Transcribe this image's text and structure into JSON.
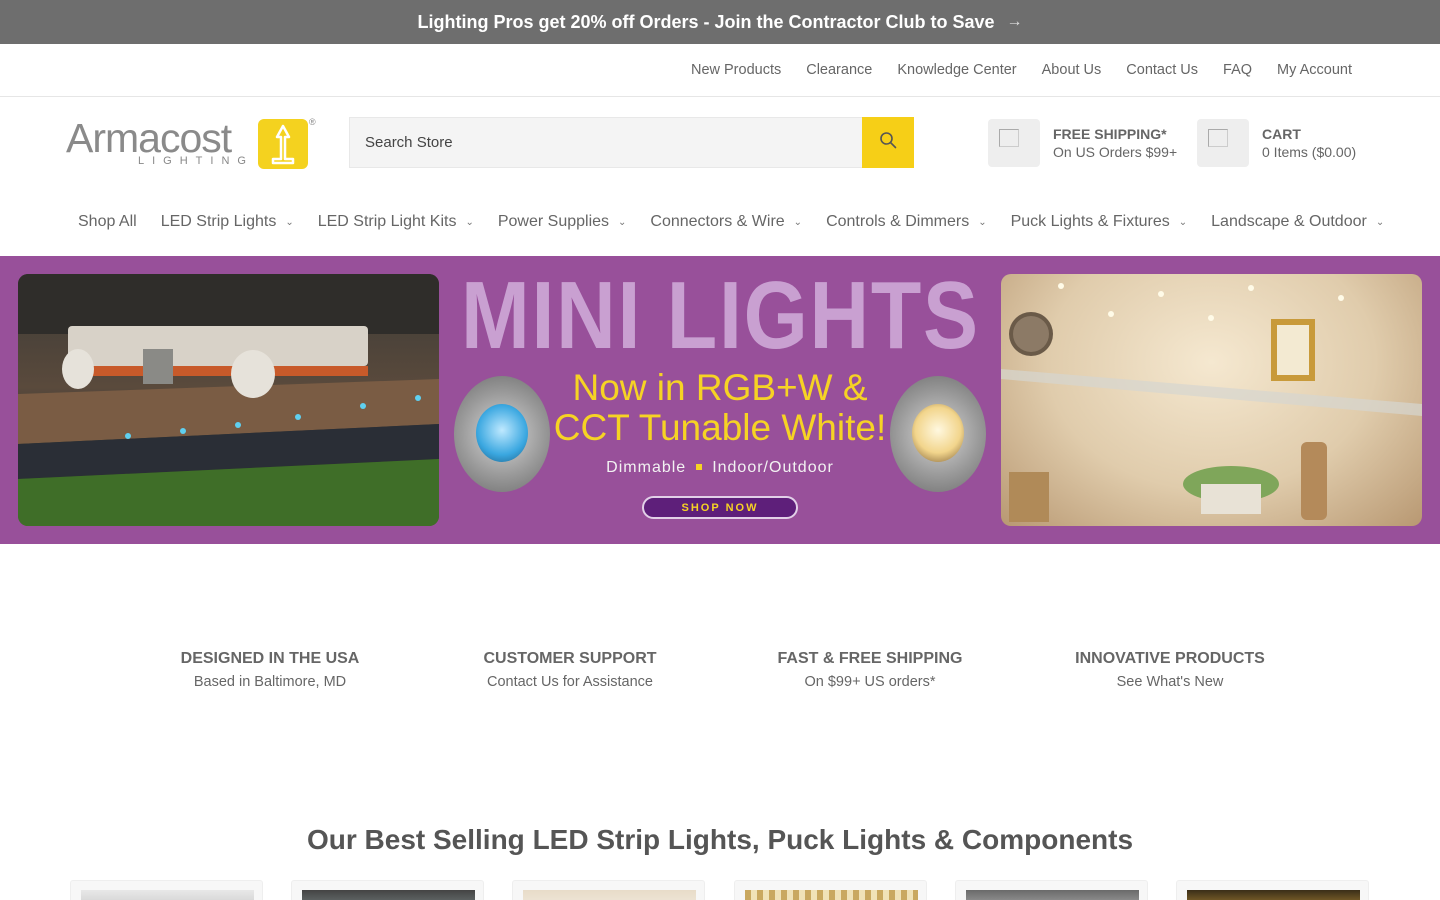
{
  "announcement": {
    "text": "Lighting Pros get 20% off Orders - Join the Contractor Club to Save",
    "arrow": "→"
  },
  "utility_nav": [
    "New Products",
    "Clearance",
    "Knowledge Center",
    "About Us",
    "Contact Us",
    "FAQ",
    "My Account"
  ],
  "logo": {
    "word": "Armacost",
    "sub": "LIGHTING",
    "reg": "®"
  },
  "search": {
    "placeholder": "Search Store",
    "icon": "search-icon"
  },
  "shipping": {
    "title": "FREE SHIPPING*",
    "subtitle": "On US Orders $99+"
  },
  "cart": {
    "title": "CART",
    "subtitle": "0 Items ($0.00)"
  },
  "main_nav": [
    {
      "label": "Shop All",
      "dropdown": false
    },
    {
      "label": "LED Strip Lights",
      "dropdown": true
    },
    {
      "label": "LED Strip Light Kits",
      "dropdown": true
    },
    {
      "label": "Power Supplies",
      "dropdown": true
    },
    {
      "label": "Connectors & Wire",
      "dropdown": true
    },
    {
      "label": "Controls & Dimmers",
      "dropdown": true
    },
    {
      "label": "Puck Lights & Fixtures",
      "dropdown": true
    },
    {
      "label": "Landscape & Outdoor",
      "dropdown": true
    }
  ],
  "hero": {
    "headline": "MINI LIGHTS",
    "line2a": "Now in RGB+W &",
    "line2b": "CCT Tunable White!",
    "tag1": "Dimmable",
    "tag2": "Indoor/Outdoor",
    "cta": "SHOP NOW",
    "colors": {
      "background": "#98509a",
      "accent": "#f6d324",
      "headline": "#c9a0d1"
    }
  },
  "features": [
    {
      "title": "DESIGNED IN THE USA",
      "subtitle": "Based in Baltimore, MD"
    },
    {
      "title": "CUSTOMER SUPPORT",
      "subtitle": "Contact Us for Assistance"
    },
    {
      "title": "FAST & FREE SHIPPING",
      "subtitle": "On $99+ US orders*"
    },
    {
      "title": "INNOVATIVE PRODUCTS",
      "subtitle": "See What's New"
    }
  ],
  "best_sellers": {
    "heading": "Our Best Selling LED Strip Lights, Puck Lights & Components"
  },
  "colors": {
    "announcement_bg": "#6e6e6e",
    "brand_yellow": "#f6cf17"
  }
}
